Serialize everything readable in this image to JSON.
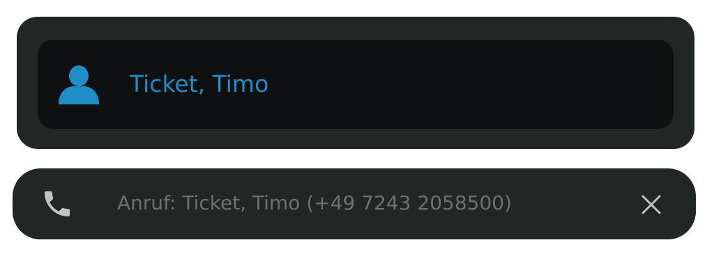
{
  "contact_card": {
    "name": "Ticket, Timo",
    "icon": "person-icon"
  },
  "call_notification": {
    "icon": "phone-icon",
    "text": "Anruf: Ticket, Timo (+49 7243 2058500)",
    "close_icon": "close-icon"
  },
  "colors": {
    "panel": "#222725",
    "inner_panel": "#0f1011",
    "accent": "#1d8ec6",
    "muted_text": "#6c706e",
    "icon_gray": "#bfc3c1"
  }
}
